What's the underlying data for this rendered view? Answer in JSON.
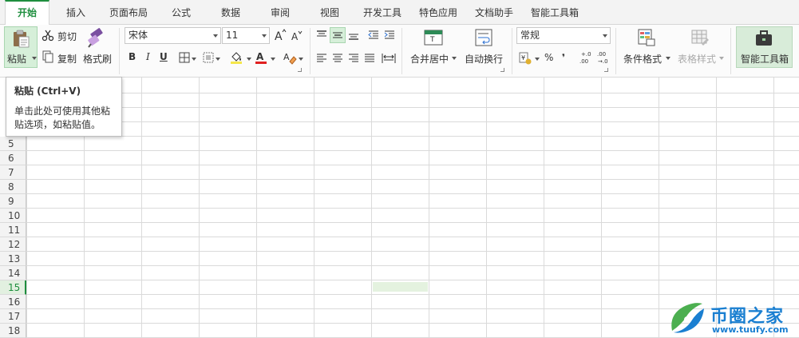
{
  "tabs": [
    {
      "label": "开始",
      "active": true
    },
    {
      "label": "插入",
      "active": false
    },
    {
      "label": "页面布局",
      "active": false
    },
    {
      "label": "公式",
      "active": false
    },
    {
      "label": "数据",
      "active": false
    },
    {
      "label": "审阅",
      "active": false
    },
    {
      "label": "视图",
      "active": false
    },
    {
      "label": "开发工具",
      "active": false
    },
    {
      "label": "特色应用",
      "active": false
    },
    {
      "label": "文档助手",
      "active": false
    },
    {
      "label": "智能工具箱",
      "active": false
    }
  ],
  "clipboard": {
    "paste_label": "粘贴",
    "cut_label": "剪切",
    "copy_label": "复制",
    "format_painter_label": "格式刷"
  },
  "font": {
    "family_value": "宋体",
    "size_value": "11",
    "bold": "B",
    "italic": "I",
    "underline": "U"
  },
  "alignment": {
    "merge_center_label": "合并居中",
    "wrap_text_label": "自动换行"
  },
  "number": {
    "format_value": "常规",
    "percent": "%",
    "comma": "❜",
    "inc_decimal": ".0\n.00",
    "dec_decimal": ".00\n.0"
  },
  "styles": {
    "conditional_format_label": "条件格式",
    "table_style_label": "表格样式"
  },
  "smart_toolbox_label": "智能工具箱",
  "tooltip": {
    "title": "粘贴 (Ctrl+V)",
    "body": "单击此处可使用其他粘贴选项，如粘贴值。"
  },
  "rows": [
    "5",
    "6",
    "7",
    "8",
    "9",
    "10",
    "11",
    "12",
    "13",
    "14",
    "15",
    "16",
    "17",
    "18"
  ],
  "selected_row": "15",
  "watermark": {
    "name": "币圈之家",
    "url": "www.tuufy.com"
  },
  "colors": {
    "accent": "#1e8e3e",
    "highlight_fill": "#f5e64a",
    "font_color": "#e02020"
  }
}
